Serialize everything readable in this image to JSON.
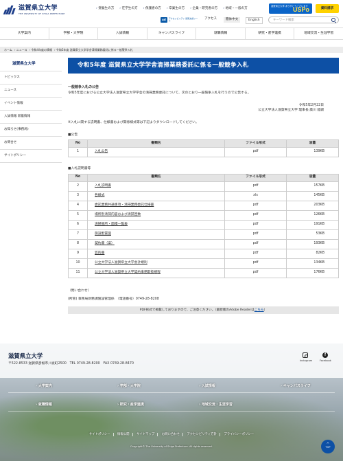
{
  "header": {
    "logo_title": "滋賀県立大学",
    "logo_sub": "THE UNIVERSITY OF SHIGA PREFECTURE",
    "audience_links": [
      "受験生の方",
      "在学生の方",
      "保護者の方",
      "卒業生の方",
      "企業・研究者の方",
      "地域・一般の方"
    ],
    "banner_text": "滋賀県立大学 ありがとうございます",
    "banner_brand": "USPo",
    "shiryo_label": "資料請求",
    "ud_badge": "ud",
    "ud_text": "アクセシビリティ 閲覧支援ツール",
    "access_label": "アクセス",
    "lang_ja": "簡体中文",
    "lang_en": "English",
    "search_placeholder": "キーワード検索"
  },
  "gnav": [
    "大学案内",
    "学部・大学院",
    "入試情報",
    "キャンパスライフ",
    "就職情報",
    "研究・産学連携",
    "地域交流・生涯学習"
  ],
  "breadcrumb": [
    "ホーム",
    "ニュース",
    "令和4年度の情報",
    "令和5年度 滋賀県立大学学舎清掃業務委託に係る一般競争入札"
  ],
  "sidebar": {
    "head": "滋賀県立大学",
    "items": [
      "トピックス",
      "ニュース",
      "イベント情報",
      "入試情報 新着情報",
      "お知らせ(事務局)",
      "お問合せ",
      "サイトポリシー"
    ]
  },
  "main": {
    "title": "令和5年度 滋賀県立大学学舎清掃業務委託に係る一般競争入札",
    "notice_heading": "一般競争入札の公告",
    "notice_text": "令和5年度における公立大学法人滋賀県立大学学舎の清掃業務委託について、次のとおり一般競争入札を行うので公告する。",
    "date": "令和5年2月22日",
    "signer": "公立大学法人滋賀県立大学 理事長 廣川 能嗣",
    "note": "※入札に関する説明書、仕様書および関係様式等は下記よりダウンロードしてください。",
    "label_kokoku": "■公告",
    "label_setsumei": "■入札説明書等",
    "table_headers": [
      "No",
      "書類名",
      "ファイル形式",
      "容量"
    ],
    "kokoku_rows": [
      {
        "no": "1",
        "name": "入札公告",
        "type": "pdf",
        "size": "139KB"
      }
    ],
    "setsumei_rows": [
      {
        "no": "2",
        "name": "入札説明書",
        "type": "pdf",
        "size": "157KB"
      },
      {
        "no": "3",
        "name": "各様式",
        "type": "xls",
        "size": "145KB"
      },
      {
        "no": "4",
        "name": "委託業務共通事項・清掃業務委託仕様書",
        "type": "pdf",
        "size": "203KB"
      },
      {
        "no": "5",
        "name": "場所別清掃内容および清掃回数",
        "type": "pdf",
        "size": "126KB"
      },
      {
        "no": "6",
        "name": "清掃箇所・面積一覧表",
        "type": "pdf",
        "size": "191KB"
      },
      {
        "no": "7",
        "name": "施設配置図",
        "type": "pdf",
        "size": "53KB"
      },
      {
        "no": "8",
        "name": "契約書（案）",
        "type": "pdf",
        "size": "193KB"
      },
      {
        "no": "9",
        "name": "質的書",
        "type": "pdf",
        "size": "82KB"
      },
      {
        "no": "10",
        "name": "公立大学法人滋賀県立大学会計規則",
        "type": "pdf",
        "size": "134KB"
      },
      {
        "no": "11",
        "name": "公立大学法人滋賀県立大学契約事務取扱規程",
        "type": "pdf",
        "size": "176KB"
      }
    ],
    "contact_label": "（問い合わせ）",
    "contact_text": "(所管) 事務局財務課施設管理係　（電話番号）0749-28-8208",
    "pdf_note": "PDF形式で掲載しておりますので、ご注意ください。（最新版のAdobe Readerは",
    "pdf_link": "こちら",
    "pdf_end": "）"
  },
  "footer": {
    "title": "滋賀県立大学",
    "address": "〒522-8533 滋賀県彦根市八坂町2500　TEL 0749-28-8200　FAX 0749-28-8470",
    "instagram": "Instagram",
    "facebook": "Facebook",
    "nav_row1": [
      "大学案内",
      "学部・大学院",
      "入試情報",
      "キャンパスライフ"
    ],
    "nav_row2": [
      "就職情報",
      "研究・産学連携",
      "地域交流・生涯学習"
    ],
    "links": [
      "サイトポリシー",
      "情報公開",
      "サイトマップ",
      "お問い合わせ",
      "アクセシビリティ方針",
      "プライバシーポリシー"
    ],
    "copyright": "Copyright© The University of Shiga Prefecture. All rights reserved.",
    "totop": "TOP"
  }
}
